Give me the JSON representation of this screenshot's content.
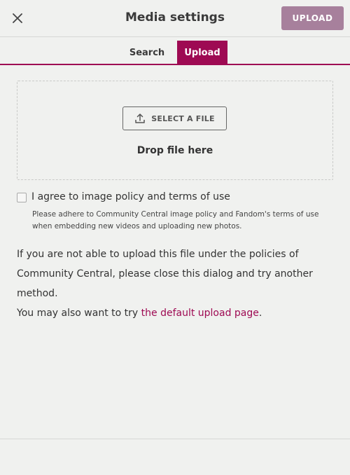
{
  "header": {
    "title": "Media settings",
    "close_icon": "close-icon",
    "upload_label": "UPLOAD"
  },
  "tabs": [
    {
      "label": "Search",
      "active": false
    },
    {
      "label": "Upload",
      "active": true
    }
  ],
  "dropzone": {
    "select_label": "SELECT A FILE",
    "select_icon": "upload-icon",
    "drop_text": "Drop file here"
  },
  "agreement": {
    "checked": false,
    "label": "I agree to image policy and terms of use",
    "note": "Please adhere to Community Central image policy and Fandom's terms of use when embedding new videos and uploading new photos."
  },
  "policy": {
    "text": "If you are not able to upload this file under the policies of Community Central, please close this dialog and try another method.",
    "alt_prefix": "You may also want to try ",
    "alt_link": "the default upload page",
    "alt_suffix": "."
  },
  "colors": {
    "accent": "#9e0a53",
    "upload_button_disabled": "#a7809c",
    "background": "#f0f1ef"
  }
}
